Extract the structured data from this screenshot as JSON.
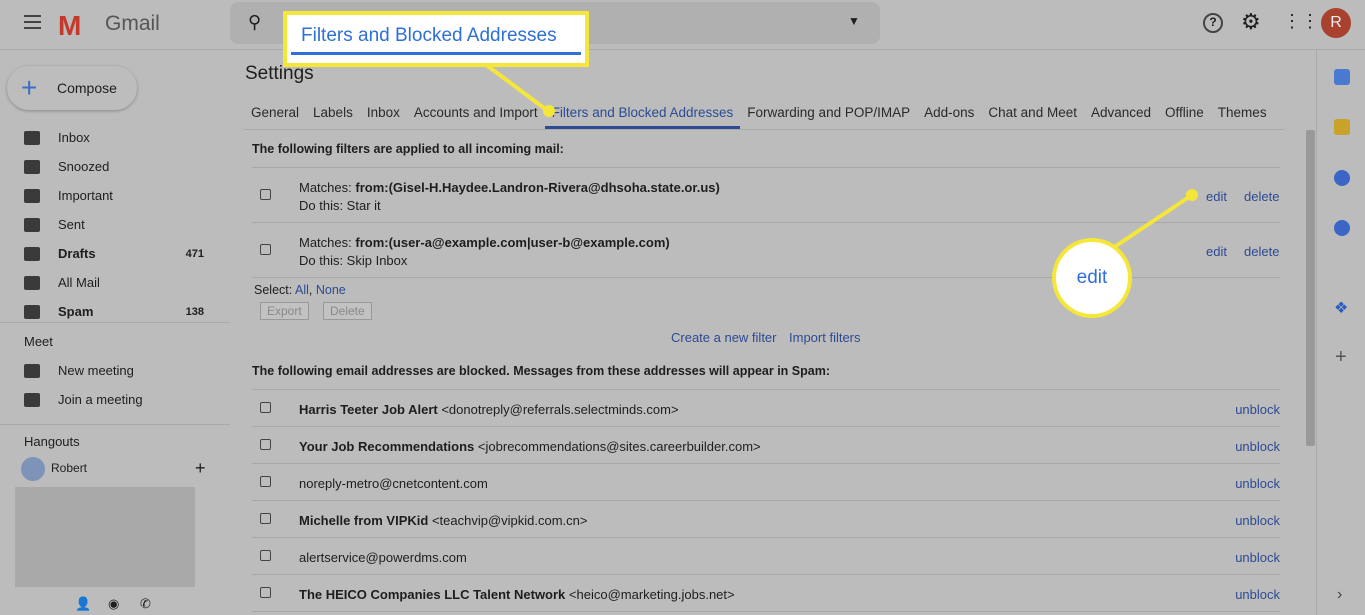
{
  "app": {
    "name": "Gmail",
    "avatar": "R"
  },
  "compose": "Compose",
  "nav": [
    {
      "label": "Inbox",
      "count": "",
      "bold": false
    },
    {
      "label": "Snoozed",
      "count": "",
      "bold": false
    },
    {
      "label": "Important",
      "count": "",
      "bold": false
    },
    {
      "label": "Sent",
      "count": "",
      "bold": false
    },
    {
      "label": "Drafts",
      "count": "471",
      "bold": true
    },
    {
      "label": "All Mail",
      "count": "",
      "bold": false
    },
    {
      "label": "Spam",
      "count": "138",
      "bold": true
    }
  ],
  "meet": {
    "title": "Meet",
    "items": [
      "New meeting",
      "Join a meeting"
    ]
  },
  "hangouts": {
    "title": "Hangouts",
    "user": "Robert"
  },
  "settings_title": "Settings",
  "tabs": [
    "General",
    "Labels",
    "Inbox",
    "Accounts and Import",
    "Filters and Blocked Addresses",
    "Forwarding and POP/IMAP",
    "Add-ons",
    "Chat and Meet",
    "Advanced",
    "Offline",
    "Themes"
  ],
  "filters": {
    "heading": "The following filters are applied to all incoming mail:",
    "items": [
      {
        "matches_label": "Matches: ",
        "matches": "from:(Gisel-H.Haydee.Landron-Rivera@dhsoha.state.or.us)",
        "action": "Do this: Star it"
      },
      {
        "matches_label": "Matches: ",
        "matches": "from:(user-a@example.com|user-b@example.com)",
        "action": "Do this: Skip Inbox"
      }
    ],
    "edit": "edit",
    "delete": "delete",
    "select_label": "Select: ",
    "all": "All",
    "none": "None",
    "export": "Export",
    "delete_btn": "Delete",
    "create": "Create a new filter",
    "import": "Import filters"
  },
  "blocked": {
    "heading": "The following email addresses are blocked. Messages from these addresses will appear in Spam:",
    "unblock": "unblock",
    "items": [
      {
        "name": "Harris Teeter Job Alert",
        "email": "<donotreply@referrals.selectminds.com>"
      },
      {
        "name": "Your Job Recommendations",
        "email": "<jobrecommendations@sites.careerbuilder.com>"
      },
      {
        "name": "",
        "email": "noreply-metro@cnetcontent.com"
      },
      {
        "name": "Michelle from VIPKid",
        "email": "<teachvip@vipkid.com.cn>"
      },
      {
        "name": "",
        "email": "alertservice@powerdms.com"
      },
      {
        "name": "The HEICO Companies LLC Talent Network",
        "email": "<heico@marketing.jobs.net>"
      }
    ]
  },
  "callouts": {
    "tab": "Filters and Blocked Addresses",
    "edit": "edit"
  },
  "colors": {
    "highlight": "#f5e63a",
    "link": "#2d4a94"
  }
}
